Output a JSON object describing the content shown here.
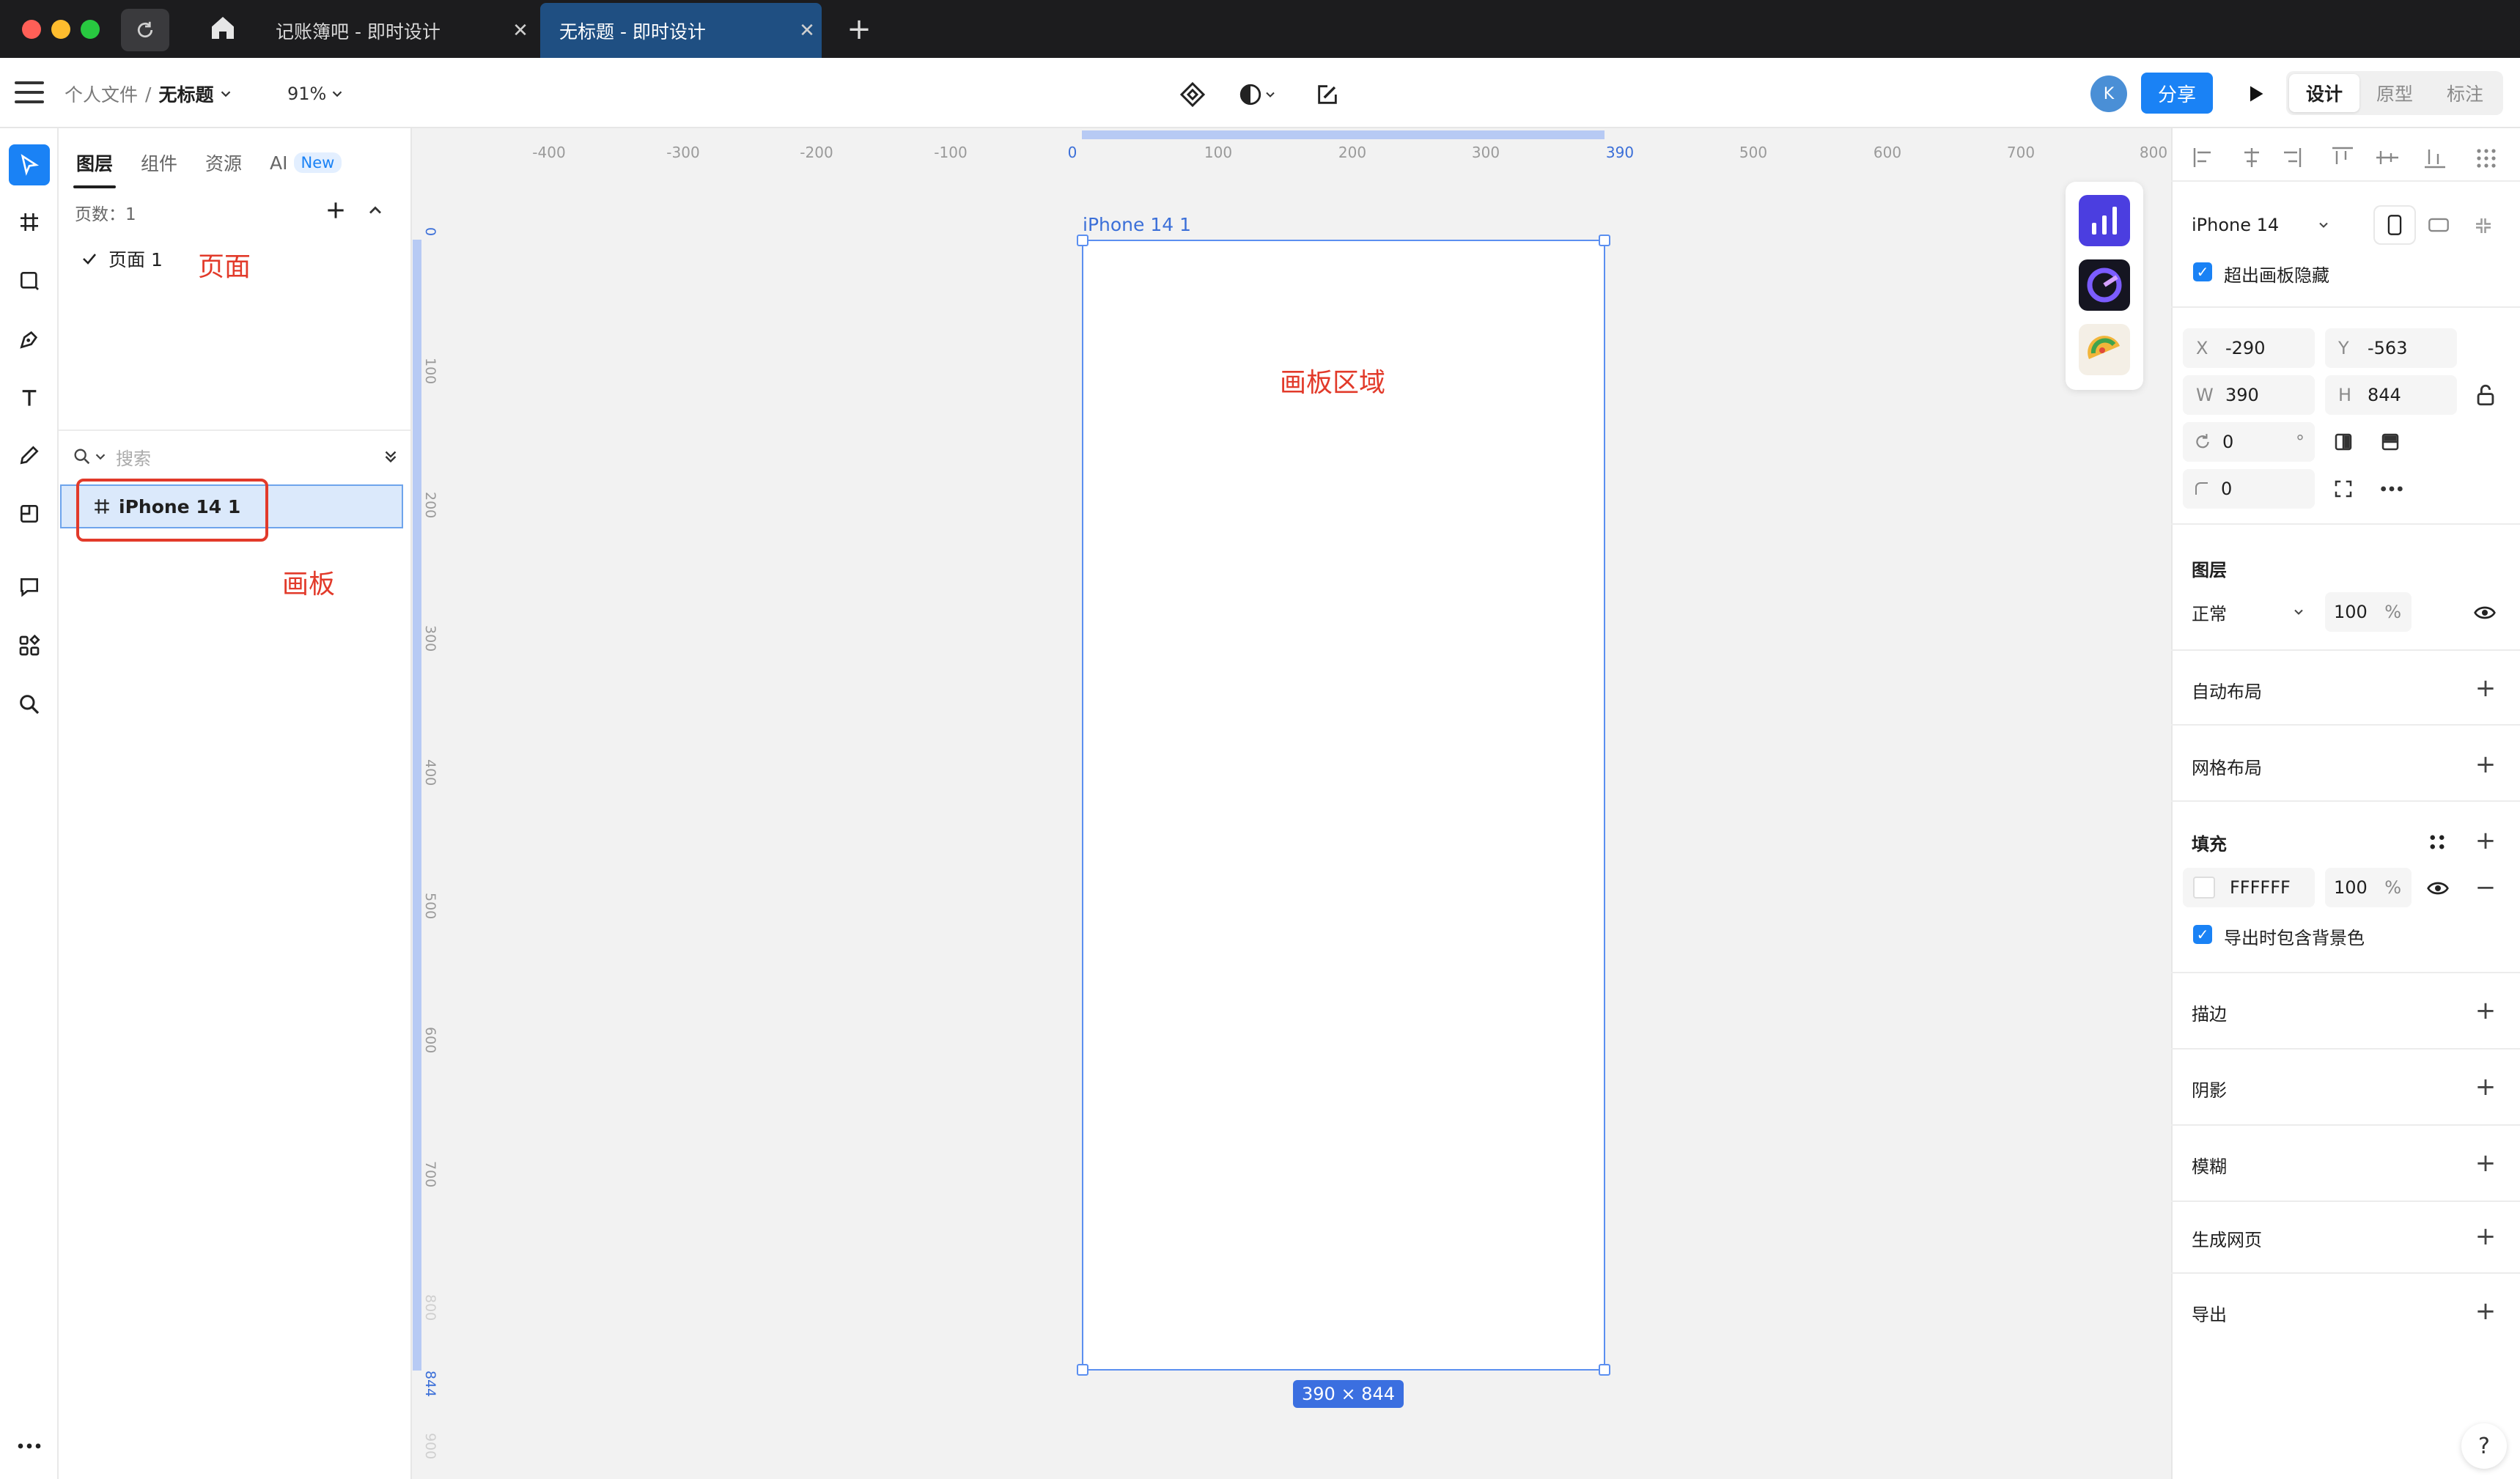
{
  "window": {
    "tabs": [
      {
        "label": "记账簿吧 - 即时设计"
      },
      {
        "label": "无标题 - 即时设计"
      }
    ]
  },
  "toolbar": {
    "breadcrumb": {
      "root": "个人文件",
      "separator": "/",
      "current": "无标题"
    },
    "zoom": "91%",
    "avatar_initial": "K",
    "share_label": "分享",
    "modes": [
      "设计",
      "原型",
      "标注"
    ]
  },
  "layers_panel": {
    "tabs": [
      "图层",
      "组件",
      "资源",
      "AI"
    ],
    "new_badge": "New",
    "pages_count_label": "页数：1",
    "pages": [
      {
        "label": "页面 1"
      }
    ],
    "search_placeholder": "搜索",
    "layers": [
      {
        "label": "iPhone 14 1"
      }
    ]
  },
  "annotations": {
    "page": "页面",
    "artboard": "画板",
    "canvas": "画板区域"
  },
  "canvas": {
    "h_ruler_ticks": [
      "-400",
      "-300",
      "-200",
      "-100",
      "0",
      "100",
      "200",
      "300",
      "390",
      "500",
      "600",
      "700",
      "800"
    ],
    "v_ruler_ticks": [
      "0",
      "100",
      "200",
      "300",
      "400",
      "500",
      "600",
      "700",
      "800",
      "844",
      "900"
    ],
    "artboard_label": "iPhone 14 1",
    "size_badge": "390 × 844"
  },
  "properties": {
    "device": "iPhone 14",
    "clip_content_label": "超出画板隐藏",
    "x_label": "X",
    "x": "-290",
    "y_label": "Y",
    "y": "-563",
    "w_label": "W",
    "w": "390",
    "h_label": "H",
    "h": "844",
    "rotation": "0",
    "rotation_unit": "°",
    "radius": "0",
    "layer_title": "图层",
    "blend_mode": "正常",
    "opacity": "100",
    "percent": "%",
    "auto_layout": "自动布局",
    "grid_layout": "网格布局",
    "fill_title": "填充",
    "fill_color": "FFFFFF",
    "fill_opacity": "100",
    "export_bg_label": "导出时包含背景色",
    "stroke": "描边",
    "shadow": "阴影",
    "blur": "模糊",
    "generate_web": "生成网页",
    "export": "导出"
  },
  "colors": {
    "accent": "#1a82f5",
    "annotation_red": "#e23a2a",
    "selection_blue": "#5b8ff0"
  }
}
